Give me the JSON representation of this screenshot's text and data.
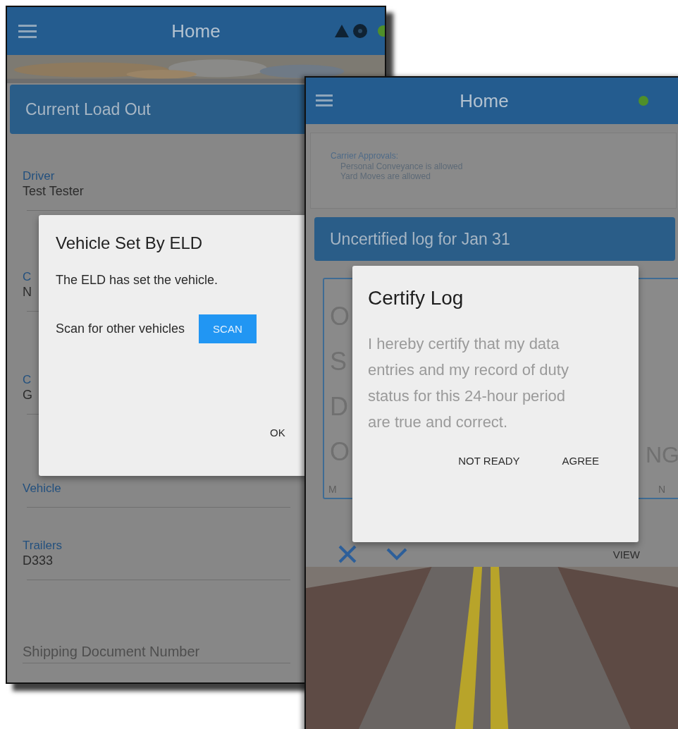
{
  "load_out_screen": {
    "header": {
      "title": "Home"
    },
    "card_title": "Current Load Out",
    "fields": [
      {
        "label": "Driver",
        "value": "Test Tester"
      },
      {
        "label": "C",
        "value": "N"
      },
      {
        "label": "C",
        "value": "G"
      },
      {
        "label": "Vehicle"
      },
      {
        "label": "Trailers",
        "value": "D333"
      },
      {
        "placeholder": "Shipping Document Number"
      }
    ],
    "dialog": {
      "title": "Vehicle Set By ELD",
      "message": "The ELD has set the vehicle.",
      "scan_prompt": "Scan for other vehicles",
      "scan_button": "SCAN",
      "ok_button": "OK"
    }
  },
  "log_screen": {
    "header": {
      "title": "Home"
    },
    "approvals": {
      "title": "Carrier Approvals:",
      "items": [
        "Personal Conveyance is allowed",
        "Yard Moves are allowed"
      ]
    },
    "log_card_title": "Uncertified log for Jan 31",
    "grid": {
      "row_labels": [
        "O",
        "S",
        "D",
        "O"
      ],
      "column_3": "NG",
      "footer_left": "M",
      "footer_right": "N"
    },
    "view_button": "VIEW",
    "dialog": {
      "title": "Certify Log",
      "message": "I hereby certify that my data entries and my record of duty status for this 24-hour period are true and correct.",
      "buttons": [
        "NOT READY",
        "AGREE"
      ]
    }
  }
}
